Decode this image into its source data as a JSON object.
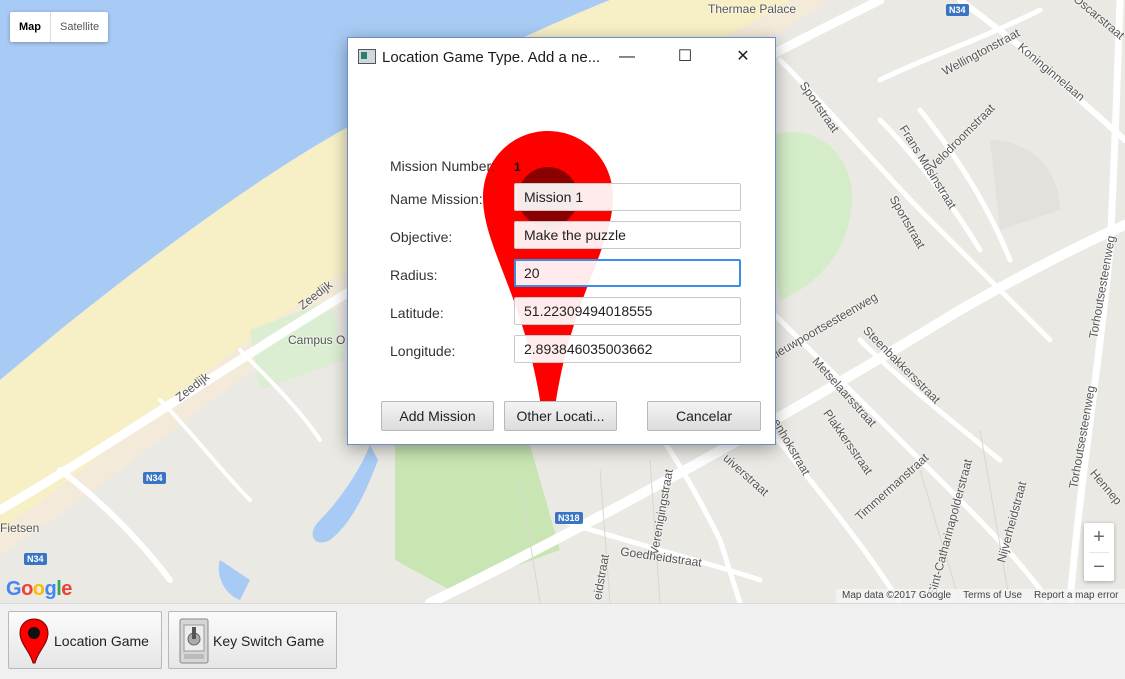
{
  "map": {
    "type_buttons": [
      "Map",
      "Satellite"
    ],
    "zoom_in": "+",
    "zoom_out": "−",
    "google_logo": {
      "G": "G",
      "o1": "o",
      "o2": "o",
      "g": "g",
      "l": "l",
      "e": "e"
    },
    "attribution": [
      "Map data ©2017 Google",
      "Terms of Use",
      "Report a map error"
    ],
    "labels": {
      "thermae": "Thermae Palace",
      "wellington": "Wellingtonstraat",
      "koninginne": "Koninginnelaan",
      "velodroom": "Velodroomstraat",
      "frans": "Frans Musinstraat",
      "sportstraat1": "Sportstraat",
      "sportstraat2": "Sportstraat",
      "zeedijk1": "Zeedijk",
      "zeedijk2": "Zeedijk",
      "campus": "Campus O",
      "nieuwpoort": "Nieuwpoortsesteenweg",
      "steenbakkers": "Steenbakkersstraat",
      "metselaars": "Metselaarsstraat",
      "plakkers": "Plakkersstraat",
      "timmerman": "Timmermanstraat",
      "catharina": "Sint-Catharinapolderstraat",
      "nijverheid": "Nijverheidstraat",
      "torhout1": "Torhoutsesteenweg",
      "torhout2": "Torhoutsesteenweg",
      "verenigings": "Verenigingstraat",
      "goedheid": "Goedheidstraat",
      "fietsen": "Fietsen",
      "hennep": "Hennep",
      "dscarstraat": "Oscarstraat",
      "ruiverstraat": "uiverstraat",
      "enhok": "enhokstraat",
      "edstraat": "eidstraat"
    },
    "shields": {
      "n34_top": "N34",
      "n34_mid": "N34",
      "n34_left": "N34",
      "n318": "N318"
    }
  },
  "dialog": {
    "title": "Location Game Type. Add a ne...",
    "minimize": "—",
    "maximize": "☐",
    "close": "✕",
    "fields": {
      "mission_number_label": "Mission Number:",
      "mission_number_value": "1",
      "name_label": "Name Mission:",
      "name_value": "Mission 1",
      "objective_label": "Objective:",
      "objective_value": "Make the puzzle",
      "radius_label": "Radius:",
      "radius_value": "20",
      "latitude_label": "Latitude:",
      "latitude_value": "51.22309494018555",
      "longitude_label": "Longitude:",
      "longitude_value": "2.893846035003662"
    },
    "buttons": {
      "add": "Add Mission",
      "other": "Other Locati...",
      "cancel": "Cancelar"
    },
    "accent_color": "#ff0000"
  },
  "toolbar": {
    "location_game": "Location Game",
    "key_switch_game": "Key Switch Game"
  }
}
